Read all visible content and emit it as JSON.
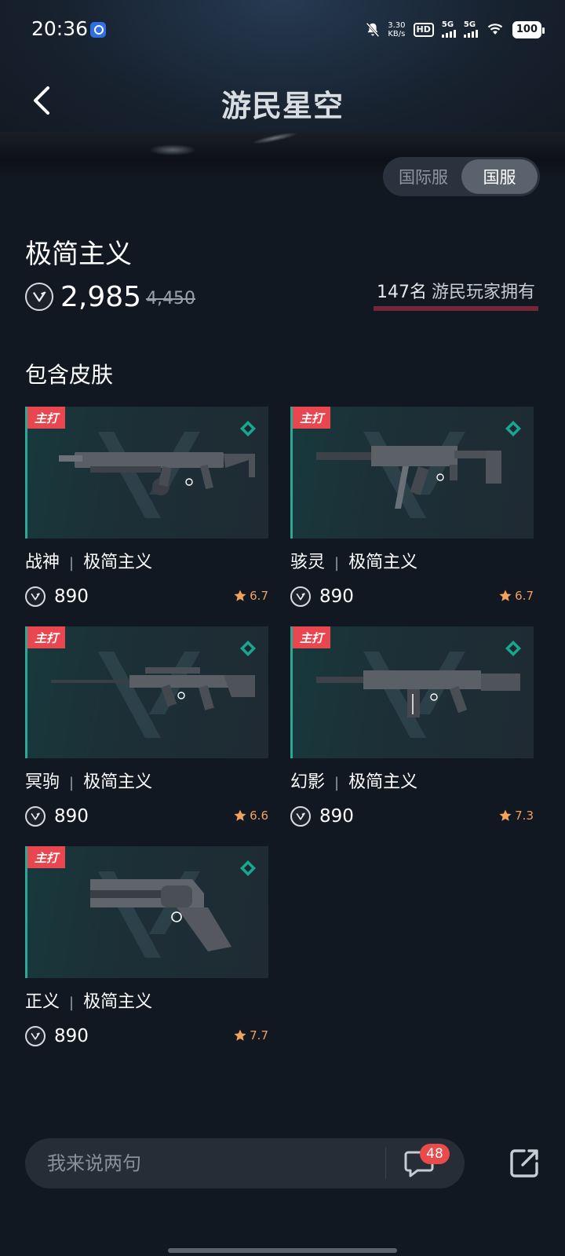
{
  "status_bar": {
    "time": "20:36",
    "net_speed_value": "3.30",
    "net_speed_unit": "KB/s",
    "hd_label": "HD",
    "signal1_label": "5G",
    "signal2_label": "5G",
    "battery": "100"
  },
  "nav": {
    "logo_text": "游民星空"
  },
  "server_toggle": {
    "options": [
      "国际服",
      "国服"
    ],
    "selected": "国服"
  },
  "bundle": {
    "title": "极简主义",
    "price": "2,985",
    "original_price": "4,450",
    "owners_count": "147名",
    "owners_text": "游民玩家拥有"
  },
  "section_title": "包含皮肤",
  "skins": [
    {
      "weapon": "战神",
      "collection": "极简主义",
      "price": "890",
      "rating": "6.7",
      "tag": "主打"
    },
    {
      "weapon": "骇灵",
      "collection": "极简主义",
      "price": "890",
      "rating": "6.7",
      "tag": "主打"
    },
    {
      "weapon": "冥驹",
      "collection": "极简主义",
      "price": "890",
      "rating": "6.6",
      "tag": "主打"
    },
    {
      "weapon": "幻影",
      "collection": "极简主义",
      "price": "890",
      "rating": "7.3",
      "tag": "主打"
    },
    {
      "weapon": "正义",
      "collection": "极简主义",
      "price": "890",
      "rating": "7.7",
      "tag": "主打"
    }
  ],
  "separator": "|",
  "comment_bar": {
    "placeholder": "我来说两句",
    "comment_count": "48"
  },
  "colors": {
    "background": "#121821",
    "accent_teal": "#2ea896",
    "tag_red": "#e8474f",
    "rating_orange": "#f0a15e",
    "badge_red": "#e94a4a"
  },
  "icons": [
    "back-icon",
    "vp-currency-icon",
    "star-icon",
    "rank-icon",
    "comment-icon",
    "share-icon"
  ]
}
